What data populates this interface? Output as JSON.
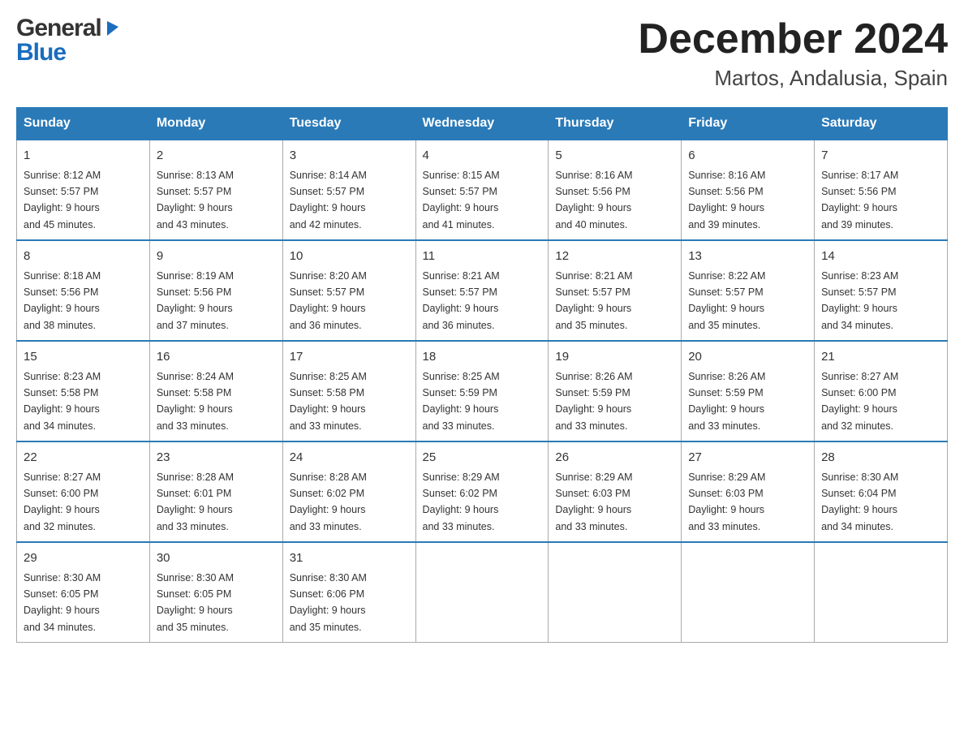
{
  "header": {
    "logo_general": "General",
    "logo_blue": "Blue",
    "month_year": "December 2024",
    "location": "Martos, Andalusia, Spain"
  },
  "weekdays": [
    "Sunday",
    "Monday",
    "Tuesday",
    "Wednesday",
    "Thursday",
    "Friday",
    "Saturday"
  ],
  "weeks": [
    [
      {
        "day": "1",
        "sunrise": "Sunrise: 8:12 AM",
        "sunset": "Sunset: 5:57 PM",
        "daylight": "Daylight: 9 hours",
        "daylight2": "and 45 minutes."
      },
      {
        "day": "2",
        "sunrise": "Sunrise: 8:13 AM",
        "sunset": "Sunset: 5:57 PM",
        "daylight": "Daylight: 9 hours",
        "daylight2": "and 43 minutes."
      },
      {
        "day": "3",
        "sunrise": "Sunrise: 8:14 AM",
        "sunset": "Sunset: 5:57 PM",
        "daylight": "Daylight: 9 hours",
        "daylight2": "and 42 minutes."
      },
      {
        "day": "4",
        "sunrise": "Sunrise: 8:15 AM",
        "sunset": "Sunset: 5:57 PM",
        "daylight": "Daylight: 9 hours",
        "daylight2": "and 41 minutes."
      },
      {
        "day": "5",
        "sunrise": "Sunrise: 8:16 AM",
        "sunset": "Sunset: 5:56 PM",
        "daylight": "Daylight: 9 hours",
        "daylight2": "and 40 minutes."
      },
      {
        "day": "6",
        "sunrise": "Sunrise: 8:16 AM",
        "sunset": "Sunset: 5:56 PM",
        "daylight": "Daylight: 9 hours",
        "daylight2": "and 39 minutes."
      },
      {
        "day": "7",
        "sunrise": "Sunrise: 8:17 AM",
        "sunset": "Sunset: 5:56 PM",
        "daylight": "Daylight: 9 hours",
        "daylight2": "and 39 minutes."
      }
    ],
    [
      {
        "day": "8",
        "sunrise": "Sunrise: 8:18 AM",
        "sunset": "Sunset: 5:56 PM",
        "daylight": "Daylight: 9 hours",
        "daylight2": "and 38 minutes."
      },
      {
        "day": "9",
        "sunrise": "Sunrise: 8:19 AM",
        "sunset": "Sunset: 5:56 PM",
        "daylight": "Daylight: 9 hours",
        "daylight2": "and 37 minutes."
      },
      {
        "day": "10",
        "sunrise": "Sunrise: 8:20 AM",
        "sunset": "Sunset: 5:57 PM",
        "daylight": "Daylight: 9 hours",
        "daylight2": "and 36 minutes."
      },
      {
        "day": "11",
        "sunrise": "Sunrise: 8:21 AM",
        "sunset": "Sunset: 5:57 PM",
        "daylight": "Daylight: 9 hours",
        "daylight2": "and 36 minutes."
      },
      {
        "day": "12",
        "sunrise": "Sunrise: 8:21 AM",
        "sunset": "Sunset: 5:57 PM",
        "daylight": "Daylight: 9 hours",
        "daylight2": "and 35 minutes."
      },
      {
        "day": "13",
        "sunrise": "Sunrise: 8:22 AM",
        "sunset": "Sunset: 5:57 PM",
        "daylight": "Daylight: 9 hours",
        "daylight2": "and 35 minutes."
      },
      {
        "day": "14",
        "sunrise": "Sunrise: 8:23 AM",
        "sunset": "Sunset: 5:57 PM",
        "daylight": "Daylight: 9 hours",
        "daylight2": "and 34 minutes."
      }
    ],
    [
      {
        "day": "15",
        "sunrise": "Sunrise: 8:23 AM",
        "sunset": "Sunset: 5:58 PM",
        "daylight": "Daylight: 9 hours",
        "daylight2": "and 34 minutes."
      },
      {
        "day": "16",
        "sunrise": "Sunrise: 8:24 AM",
        "sunset": "Sunset: 5:58 PM",
        "daylight": "Daylight: 9 hours",
        "daylight2": "and 33 minutes."
      },
      {
        "day": "17",
        "sunrise": "Sunrise: 8:25 AM",
        "sunset": "Sunset: 5:58 PM",
        "daylight": "Daylight: 9 hours",
        "daylight2": "and 33 minutes."
      },
      {
        "day": "18",
        "sunrise": "Sunrise: 8:25 AM",
        "sunset": "Sunset: 5:59 PM",
        "daylight": "Daylight: 9 hours",
        "daylight2": "and 33 minutes."
      },
      {
        "day": "19",
        "sunrise": "Sunrise: 8:26 AM",
        "sunset": "Sunset: 5:59 PM",
        "daylight": "Daylight: 9 hours",
        "daylight2": "and 33 minutes."
      },
      {
        "day": "20",
        "sunrise": "Sunrise: 8:26 AM",
        "sunset": "Sunset: 5:59 PM",
        "daylight": "Daylight: 9 hours",
        "daylight2": "and 33 minutes."
      },
      {
        "day": "21",
        "sunrise": "Sunrise: 8:27 AM",
        "sunset": "Sunset: 6:00 PM",
        "daylight": "Daylight: 9 hours",
        "daylight2": "and 32 minutes."
      }
    ],
    [
      {
        "day": "22",
        "sunrise": "Sunrise: 8:27 AM",
        "sunset": "Sunset: 6:00 PM",
        "daylight": "Daylight: 9 hours",
        "daylight2": "and 32 minutes."
      },
      {
        "day": "23",
        "sunrise": "Sunrise: 8:28 AM",
        "sunset": "Sunset: 6:01 PM",
        "daylight": "Daylight: 9 hours",
        "daylight2": "and 33 minutes."
      },
      {
        "day": "24",
        "sunrise": "Sunrise: 8:28 AM",
        "sunset": "Sunset: 6:02 PM",
        "daylight": "Daylight: 9 hours",
        "daylight2": "and 33 minutes."
      },
      {
        "day": "25",
        "sunrise": "Sunrise: 8:29 AM",
        "sunset": "Sunset: 6:02 PM",
        "daylight": "Daylight: 9 hours",
        "daylight2": "and 33 minutes."
      },
      {
        "day": "26",
        "sunrise": "Sunrise: 8:29 AM",
        "sunset": "Sunset: 6:03 PM",
        "daylight": "Daylight: 9 hours",
        "daylight2": "and 33 minutes."
      },
      {
        "day": "27",
        "sunrise": "Sunrise: 8:29 AM",
        "sunset": "Sunset: 6:03 PM",
        "daylight": "Daylight: 9 hours",
        "daylight2": "and 33 minutes."
      },
      {
        "day": "28",
        "sunrise": "Sunrise: 8:30 AM",
        "sunset": "Sunset: 6:04 PM",
        "daylight": "Daylight: 9 hours",
        "daylight2": "and 34 minutes."
      }
    ],
    [
      {
        "day": "29",
        "sunrise": "Sunrise: 8:30 AM",
        "sunset": "Sunset: 6:05 PM",
        "daylight": "Daylight: 9 hours",
        "daylight2": "and 34 minutes."
      },
      {
        "day": "30",
        "sunrise": "Sunrise: 8:30 AM",
        "sunset": "Sunset: 6:05 PM",
        "daylight": "Daylight: 9 hours",
        "daylight2": "and 35 minutes."
      },
      {
        "day": "31",
        "sunrise": "Sunrise: 8:30 AM",
        "sunset": "Sunset: 6:06 PM",
        "daylight": "Daylight: 9 hours",
        "daylight2": "and 35 minutes."
      },
      null,
      null,
      null,
      null
    ]
  ]
}
